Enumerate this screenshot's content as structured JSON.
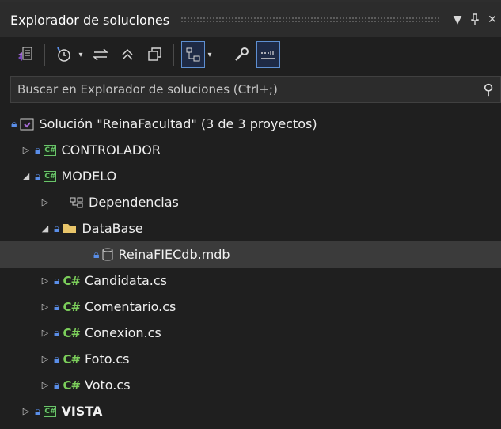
{
  "panel": {
    "title": "Explorador de soluciones",
    "dropdown_icon": "triangle-down-icon",
    "pin_icon": "pin-icon",
    "close_icon": "close-icon"
  },
  "search": {
    "placeholder": "Buscar en Explorador de soluciones (Ctrl+;)"
  },
  "tree": {
    "solution": "Solución \"ReinaFacultad\"  (3 de 3 proyectos)",
    "items": [
      {
        "label": "CONTROLADOR"
      },
      {
        "label": "MODELO"
      },
      {
        "label": "Dependencias"
      },
      {
        "label": "DataBase"
      },
      {
        "label": "ReinaFIECdb.mdb"
      },
      {
        "label": "Candidata.cs"
      },
      {
        "label": "Comentario.cs"
      },
      {
        "label": "Conexion.cs"
      },
      {
        "label": "Foto.cs"
      },
      {
        "label": "Voto.cs"
      },
      {
        "label": "VISTA"
      }
    ],
    "cs_badge": "C#",
    "cs_prefix": "C#"
  },
  "colors": {
    "lock": "#5a8ee8",
    "csharp": "#6ac46a",
    "folder": "#e8c56a",
    "selection": "#3b3b3b"
  }
}
